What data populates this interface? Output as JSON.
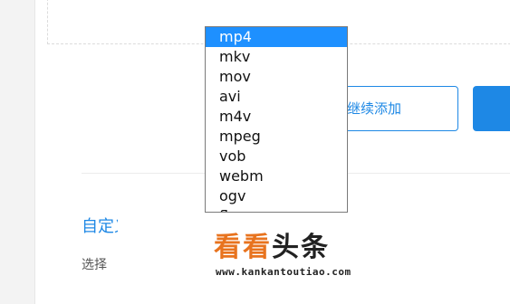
{
  "form": {
    "continue_button_label": "继续添加",
    "section_title": "自定义格式",
    "section_desc": "选择"
  },
  "format_dropdown": {
    "options": [
      "mp4",
      "mkv",
      "mov",
      "avi",
      "m4v",
      "mpeg",
      "vob",
      "webm",
      "ogv",
      "flv"
    ],
    "selected": "mp4"
  },
  "watermark": {
    "title_part1": "看看",
    "title_part2": "头条",
    "url": "www.kankantoutiao.com"
  },
  "colors": {
    "accent": "#1e88e5",
    "selection": "#1e90ff",
    "watermark_orange": "#e8731e"
  }
}
